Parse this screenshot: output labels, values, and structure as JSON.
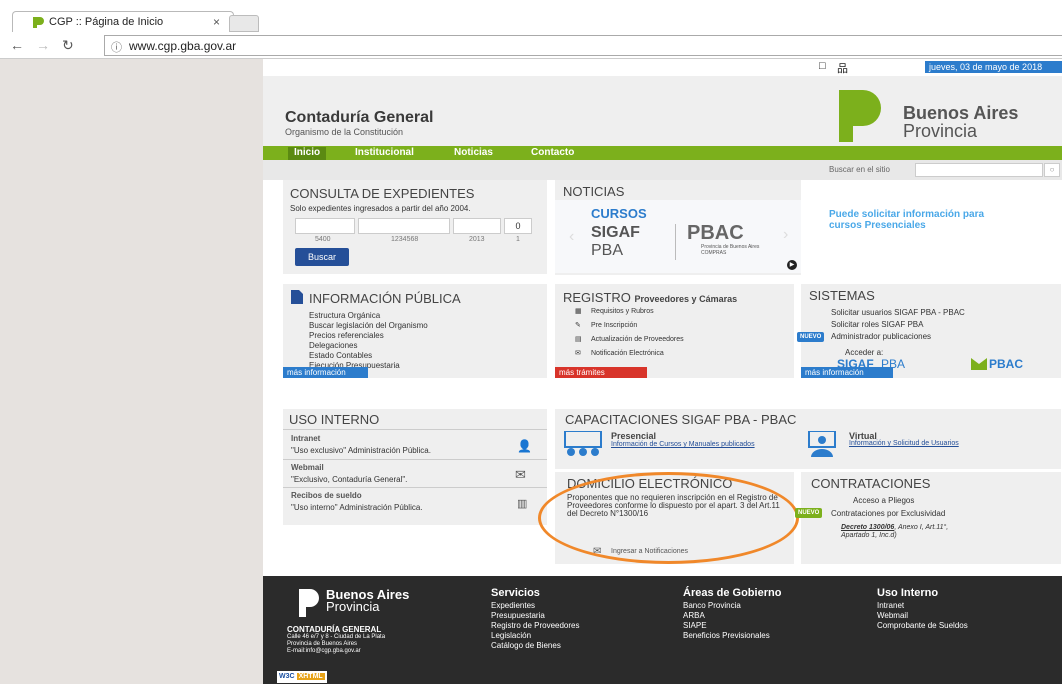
{
  "browser": {
    "tab_title": "CGP :: Página de Inicio",
    "tab_close": "×",
    "url": "www.cgp.gba.gov.ar"
  },
  "site": {
    "date": "jueves, 03 de mayo de 2018",
    "title": "Contaduría General",
    "subtitle": "Organismo de la Constitución",
    "province_name": "Buenos Aires",
    "province_word": "Provincia",
    "menu": [
      "Inicio",
      "Institucional",
      "Noticias",
      "Contacto"
    ],
    "search_label": "Buscar en el sitio"
  },
  "expedientes": {
    "title": "CONSULTA DE EXPEDIENTES",
    "note": "Solo expedientes ingresados a partir del año 2004.",
    "field4_value": "0",
    "hints": [
      "5400",
      "1234568",
      "2013",
      "1"
    ],
    "button": "Buscar"
  },
  "noticias": {
    "title": "NOTICIAS",
    "cursos": "CURSOS",
    "sigaf": "SIGAF",
    "pba": "PBA",
    "pbac": "PBAC",
    "pbac_sub1": "Provincia de Buenos Aires",
    "pbac_sub2": "COMPRAS",
    "promo": "Puede solicitar información para cursos Presenciales"
  },
  "info_publica": {
    "title": "INFORMACIÓN PÚBLICA",
    "items": [
      "Estructura Orgánica",
      "Buscar legislación del Organismo",
      "Precios referenciales",
      "Delegaciones",
      "Estado Contables",
      "Ejecución Presupuestaria"
    ],
    "more": "más información"
  },
  "registro": {
    "title": "REGISTRO",
    "title_sub": "Proveedores y Cámaras",
    "items": [
      "Requisitos y Rubros",
      "Pre Inscripción",
      "Actualización de Proveedores",
      "Notificación Electrónica"
    ],
    "more": "más trámites"
  },
  "sistemas": {
    "title": "SISTEMAS",
    "items": [
      "Solicitar usuarios SIGAF PBA - PBAC",
      "Solicitar roles SIGAF PBA",
      "Administrador publicaciones"
    ],
    "nuevo": "NUEVO",
    "acceder": "Acceder a:",
    "sigaf": "SIGAF",
    "pba": "PBA",
    "pbac": "PBAC",
    "more": "más información"
  },
  "uso_interno": {
    "title": "USO INTERNO",
    "items": [
      {
        "name": "Intranet",
        "desc": "\"Uso exclusivo\" Administración Pública."
      },
      {
        "name": "Webmail",
        "desc": "\"Exclusivo, Contaduría General\"."
      },
      {
        "name": "Recibos de sueldo",
        "desc": "\"Uso interno\" Administración Pública."
      }
    ]
  },
  "capacitaciones": {
    "title": "CAPACITACIONES SIGAF PBA - PBAC",
    "presencial": "Presencial",
    "presencial_link": "Información de Cursos y Manuales publicados",
    "virtual": "Virtual",
    "virtual_link": "Información y Solicitud de Usuarios"
  },
  "domicilio": {
    "title": "DOMICILIO ELECTRÓNICO",
    "text": "Proponentes que no requieren inscripción en el Registro de Proveedores conforme lo dispuesto por el apart. 3 del Art.11 del Decreto N°1300/16",
    "link": "Ingresar a Notificaciones"
  },
  "contrataciones": {
    "title": "CONTRATACIONES",
    "item1": "Acceso a Pliegos",
    "nuevo": "NUEVO",
    "item2": "Contrataciones por Exclusividad",
    "decreto": "Decreto 1300/06",
    "decreto_rest": ", Anexo I, Art.11°,",
    "apartado": "Apartado 1, Inc.d)"
  },
  "footer": {
    "brand_name": "Buenos Aires",
    "brand_word": "Provincia",
    "org": "CONTADURÍA GENERAL",
    "addr1": "Calle 46 e/7 y 8 - Ciudad de La Plata",
    "addr2": "Provincia de Buenos Aires",
    "email": "E-mail:info@cgp.gba.gov.ar",
    "servicios_title": "Servicios",
    "servicios": [
      "Expedientes",
      "Presupuestaria",
      "Registro de Proveedores",
      "Legislación",
      "Catálogo de Bienes"
    ],
    "areas_title": "Áreas de Gobierno",
    "areas": [
      "Banco Provincia",
      "ARBA",
      "SIAPE",
      "Beneficios Previsionales"
    ],
    "uso_title": "Uso Interno",
    "uso": [
      "Intranet",
      "Webmail",
      "Comprobante de Sueldos"
    ],
    "badge_w3c": "W3C",
    "badge_xhtml": "XHTML"
  },
  "colors": {
    "green": "#7cb01c",
    "blue": "#2c7ccc",
    "red": "#d8342a",
    "orange": "#f0882a",
    "footer": "#2b2b2b"
  }
}
